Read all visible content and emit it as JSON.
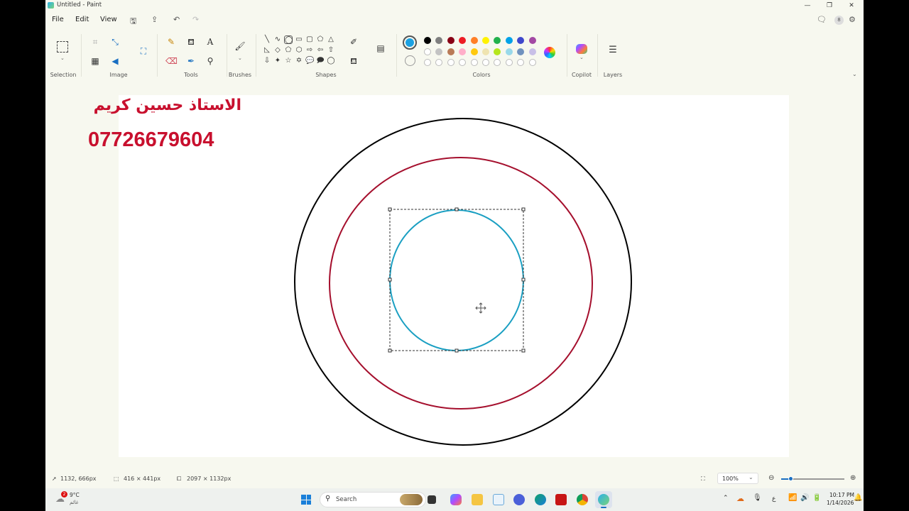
{
  "window": {
    "title": "Untitled - Paint"
  },
  "menu": {
    "file": "File",
    "edit": "Edit",
    "view": "View"
  },
  "ribbon": {
    "groups": {
      "selection": "Selection",
      "image": "Image",
      "tools": "Tools",
      "brushes": "Brushes",
      "shapes": "Shapes",
      "colors": "Colors",
      "copilot": "Copilot",
      "layers": "Layers"
    },
    "colors": {
      "primary": "#1ba1e2",
      "secondary": "#ffffff",
      "row1": [
        "#000000",
        "#7f7f7f",
        "#880015",
        "#ed1c24",
        "#ff7f27",
        "#fff200",
        "#22b14c",
        "#00a2e8",
        "#3f48cc",
        "#a349a4"
      ],
      "row2": [
        "#ffffff",
        "#c3c3c3",
        "#b97a57",
        "#ffaec9",
        "#ffc90e",
        "#efe4b0",
        "#b5e61d",
        "#99d9ea",
        "#7092be",
        "#c8bfe7"
      ]
    }
  },
  "canvas": {
    "watermark_name": "الاستاذ  حسين  كريم",
    "watermark_phone": "07726679604",
    "circles": [
      {
        "name": "outer-circle",
        "stroke": "#000000"
      },
      {
        "name": "middle-circle",
        "stroke": "#a50f2d"
      },
      {
        "name": "inner-circle",
        "stroke": "#1a9fc2"
      }
    ]
  },
  "status": {
    "cursor_pos": "1132, 666px",
    "selection_size": "416 × 441px",
    "canvas_size": "2097 × 1132px",
    "zoom": "100%"
  },
  "taskbar": {
    "weather_temp": "9°C",
    "weather_label": "غائم",
    "weather_badge": "2",
    "search_placeholder": "Search",
    "time": "10:17 PM",
    "date": "1/14/2026",
    "lang": "ع"
  }
}
